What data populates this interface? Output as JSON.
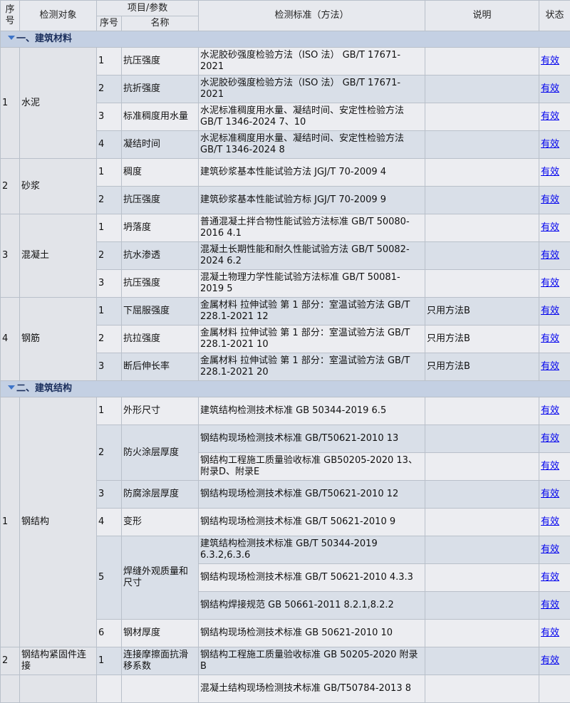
{
  "header": {
    "seq": "序号",
    "object": "检测对象",
    "params": "项目/参数",
    "sub_seq": "序号",
    "sub_name": "名称",
    "standard": "检测标准（方法）",
    "note": "说明",
    "status": "状态"
  },
  "status_text": "有效",
  "sections": [
    {
      "title": "一、建筑材料",
      "groups": [
        {
          "seq": "1",
          "object": "水泥",
          "items": [
            {
              "seq": "1",
              "name": "抗压强度",
              "standards": [
                "水泥胶砂强度检验方法（ISO 法） GB/T 17671-2021"
              ]
            },
            {
              "seq": "2",
              "name": "抗折强度",
              "standards": [
                "水泥胶砂强度检验方法（ISO 法） GB/T 17671-2021"
              ]
            },
            {
              "seq": "3",
              "name": "标准稠度用水量",
              "standards": [
                "水泥标准稠度用水量、凝结时间、安定性检验方法 GB/T 1346-2024 7、10"
              ]
            },
            {
              "seq": "4",
              "name": "凝结时间",
              "standards": [
                "水泥标准稠度用水量、凝结时间、安定性检验方法 GB/T 1346-2024 8"
              ]
            }
          ]
        },
        {
          "seq": "2",
          "object": "砂浆",
          "items": [
            {
              "seq": "1",
              "name": "稠度",
              "standards": [
                "建筑砂浆基本性能试验方法 JGJ/T 70-2009 4"
              ]
            },
            {
              "seq": "2",
              "name": "抗压强度",
              "standards": [
                "建筑砂浆基本性能试验方标 JGJ/T 70-2009 9"
              ]
            }
          ]
        },
        {
          "seq": "3",
          "object": "混凝土",
          "items": [
            {
              "seq": "1",
              "name": "坍落度",
              "standards": [
                "普通混凝土拌合物性能试验方法标准 GB/T 50080-2016 4.1"
              ]
            },
            {
              "seq": "2",
              "name": "抗水渗透",
              "standards": [
                "混凝土长期性能和耐久性能试验方法 GB/T 50082-2024 6.2"
              ]
            },
            {
              "seq": "3",
              "name": "抗压强度",
              "standards": [
                "混凝土物理力学性能试验方法标准 GB/T 50081-2019 5"
              ]
            }
          ]
        },
        {
          "seq": "4",
          "object": "钢筋",
          "items": [
            {
              "seq": "1",
              "name": "下屈服强度",
              "standards": [
                "金属材料 拉伸试验 第 1 部分：室温试验方法 GB/T 228.1-2021 12"
              ],
              "note": "只用方法B"
            },
            {
              "seq": "2",
              "name": "抗拉强度",
              "standards": [
                "金属材料 拉伸试验 第 1 部分：室温试验方法 GB/T 228.1-2021 10"
              ],
              "note": "只用方法B"
            },
            {
              "seq": "3",
              "name": "断后伸长率",
              "standards": [
                "金属材料 拉伸试验 第 1 部分：室温试验方法 GB/T 228.1-2021 20"
              ],
              "note": "只用方法B"
            }
          ]
        }
      ]
    },
    {
      "title": "二、建筑结构",
      "groups": [
        {
          "seq": "1",
          "object": "钢结构",
          "items": [
            {
              "seq": "1",
              "name": "外形尺寸",
              "standards": [
                "建筑结构检测技术标准 GB 50344-2019 6.5"
              ]
            },
            {
              "seq": "2",
              "name": "防火涂层厚度",
              "standards": [
                "钢结构现场检测技术标准 GB/T50621-2010 13",
                "钢结构工程施工质量验收标准 GB50205-2020 13、附录D、附录E"
              ]
            },
            {
              "seq": "3",
              "name": "防腐涂层厚度",
              "standards": [
                "钢结构现场检测技术标准 GB/T50621-2010 12"
              ]
            },
            {
              "seq": "4",
              "name": "变形",
              "standards": [
                "钢结构现场检测技术标准 GB/T 50621-2010 9"
              ]
            },
            {
              "seq": "5",
              "name": "焊缝外观质量和尺寸",
              "standards": [
                "建筑结构检测技术标准 GB/T 50344-2019 6.3.2,6.3.6",
                "钢结构现场检测技术标准 GB/T 50621-2010 4.3.3",
                "钢结构焊接规范 GB 50661-2011 8.2.1,8.2.2"
              ]
            },
            {
              "seq": "6",
              "name": "钢材厚度",
              "standards": [
                "钢结构现场检测技术标准 GB 50621-2010 10"
              ]
            }
          ]
        },
        {
          "seq": "2",
          "object": "钢结构紧固件连接",
          "items": [
            {
              "seq": "1",
              "name": "连接摩擦面抗滑移系数",
              "standards": [
                "钢结构工程施工质量验收标准 GB 50205-2020 附录B"
              ]
            }
          ]
        },
        {
          "seq": "",
          "object": "",
          "items": [
            {
              "seq": "",
              "name": "",
              "standards": [
                "混凝土结构现场检测技术标准 GB/T50784-2013 8"
              ]
            }
          ]
        }
      ]
    }
  ]
}
